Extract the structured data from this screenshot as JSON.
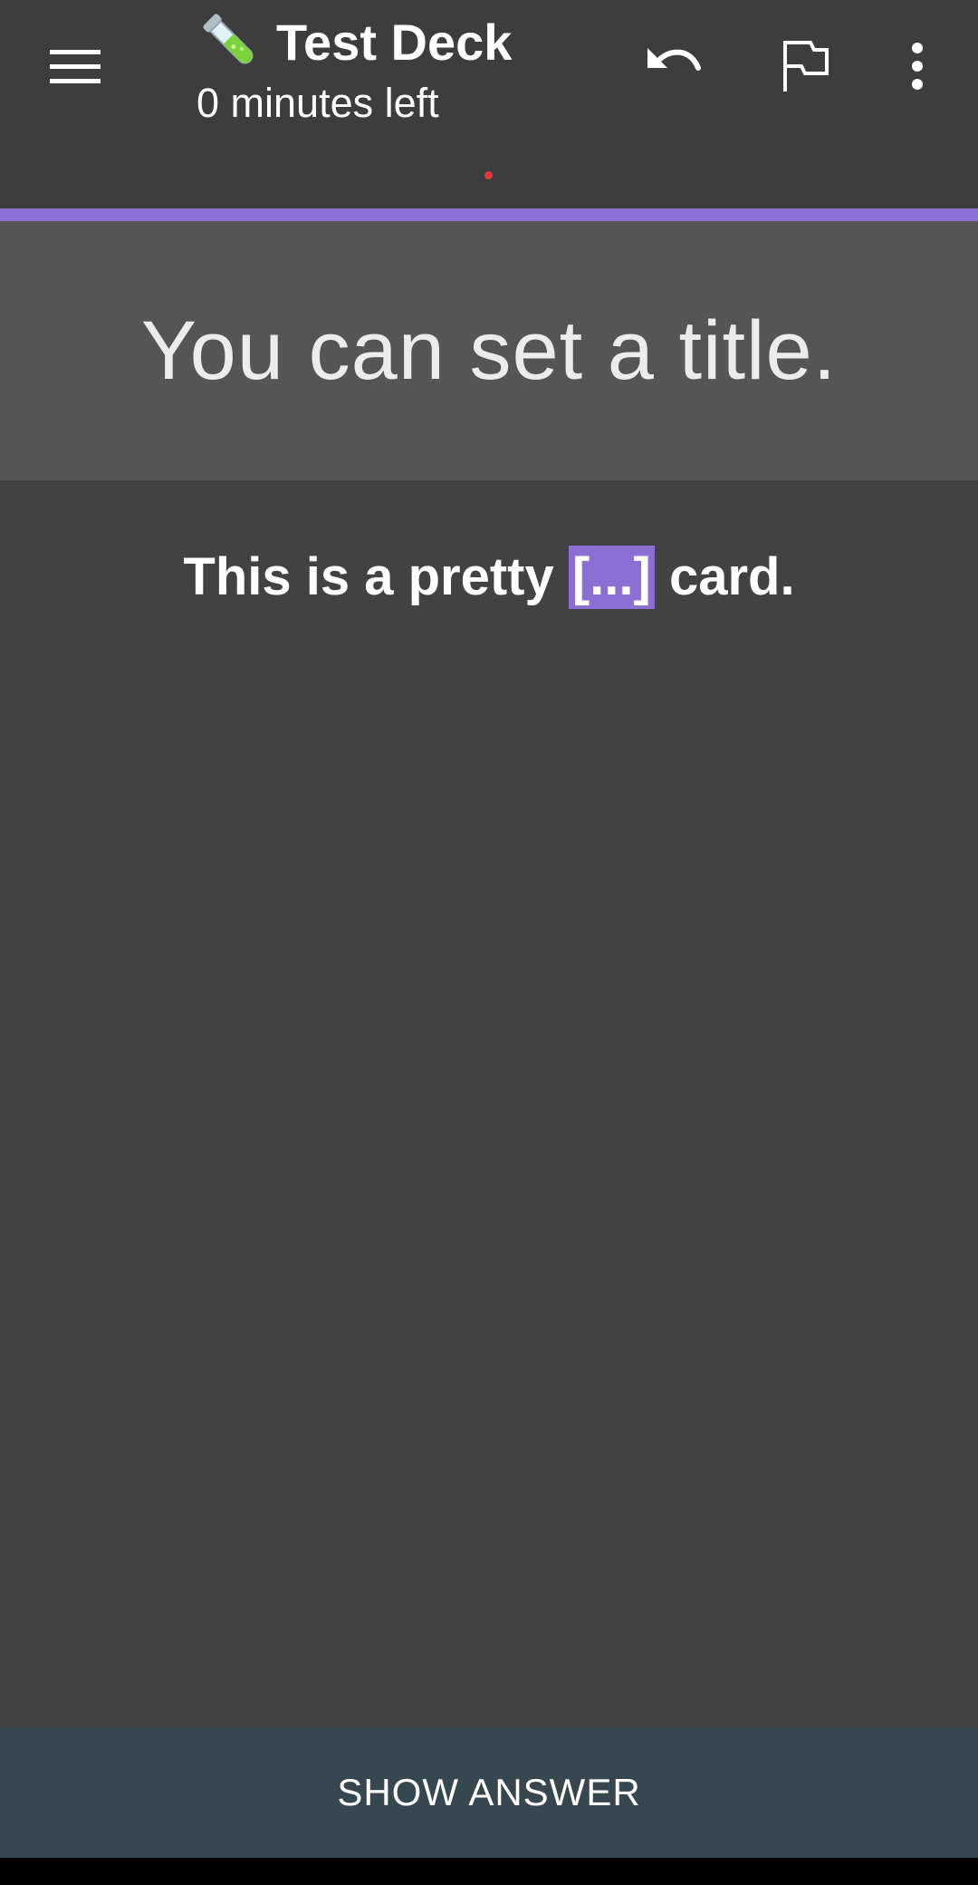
{
  "app_bar": {
    "deck_emoji": "test-tube-icon",
    "deck_title": "Test Deck",
    "subtitle": "0 minutes left",
    "menu_icon": "hamburger-menu-icon",
    "undo_icon": "undo-icon",
    "flag_icon": "flag-icon",
    "more_icon": "more-vert-icon"
  },
  "card": {
    "title": "You can set a title.",
    "question_before": "This is a pretty ",
    "cloze": "[...]",
    "question_after": " card."
  },
  "footer": {
    "show_answer_label": "SHOW ANSWER"
  },
  "colors": {
    "accent": "#8b6fd4",
    "app_bar": "#3d3d3d",
    "title_band": "#555555",
    "background": "#424242",
    "footer": "#37474f",
    "status_dot": "#e53935"
  }
}
